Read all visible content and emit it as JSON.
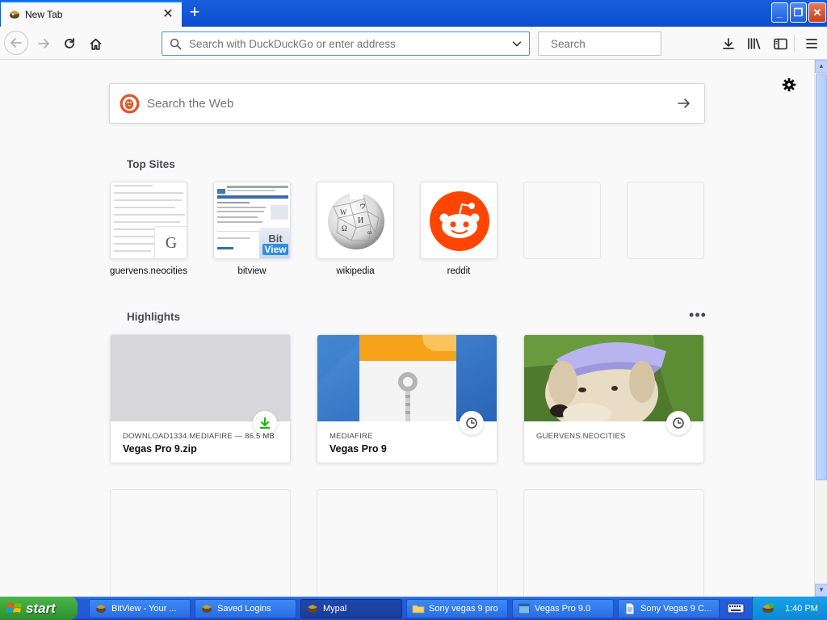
{
  "browser": {
    "tab": {
      "title": "New Tab",
      "close": "✕"
    },
    "new_tab": "+",
    "window_buttons": {
      "minimize": "_",
      "maximize": "❐",
      "close": "✕"
    },
    "urlbar": {
      "placeholder": "Search with DuckDuckGo or enter address",
      "value": ""
    },
    "searchbar": {
      "placeholder": "Search",
      "value": ""
    }
  },
  "newtab": {
    "websearch": {
      "placeholder": "Search the Web",
      "value": ""
    },
    "top_sites": {
      "title": "Top Sites",
      "sites": [
        {
          "label": "guervens.neocities",
          "badge": "G"
        },
        {
          "label": "bitview",
          "badge_top": "Bit",
          "badge_bottom": "View"
        },
        {
          "label": "wikipedia"
        },
        {
          "label": "reddit"
        },
        {
          "label": ""
        },
        {
          "label": ""
        }
      ]
    },
    "highlights": {
      "title": "Highlights",
      "more": "•••",
      "cards": [
        {
          "context": "DOWNLOAD1334.MEDIAFIRE — 86.5 MB",
          "title": "Vegas Pro 9.zip",
          "badge": "download-icon"
        },
        {
          "context": "MEDIAFIRE",
          "title": "Vegas Pro 9",
          "badge": "clock-icon"
        },
        {
          "context": "GUERVENS.NEOCITIES",
          "title": "",
          "badge": "clock-icon"
        }
      ]
    }
  },
  "taskbar": {
    "start_label": "start",
    "tasks": [
      {
        "label": "BitView - Your ...",
        "active": false
      },
      {
        "label": "Saved Logins",
        "active": false
      },
      {
        "label": "Mypal",
        "active": true
      },
      {
        "label": "Sony vegas 9 pro",
        "active": false
      },
      {
        "label": "Vegas Pro 9.0",
        "active": false
      },
      {
        "label": "Sony Vegas 9 C...",
        "active": false
      }
    ],
    "clock": "1:40 PM"
  },
  "colors": {
    "accent": "#0a84ff",
    "reddit": "#ff4500",
    "download_green": "#12bc00",
    "taskbar_blue": "#245edb",
    "start_green": "#3c9c3a"
  }
}
